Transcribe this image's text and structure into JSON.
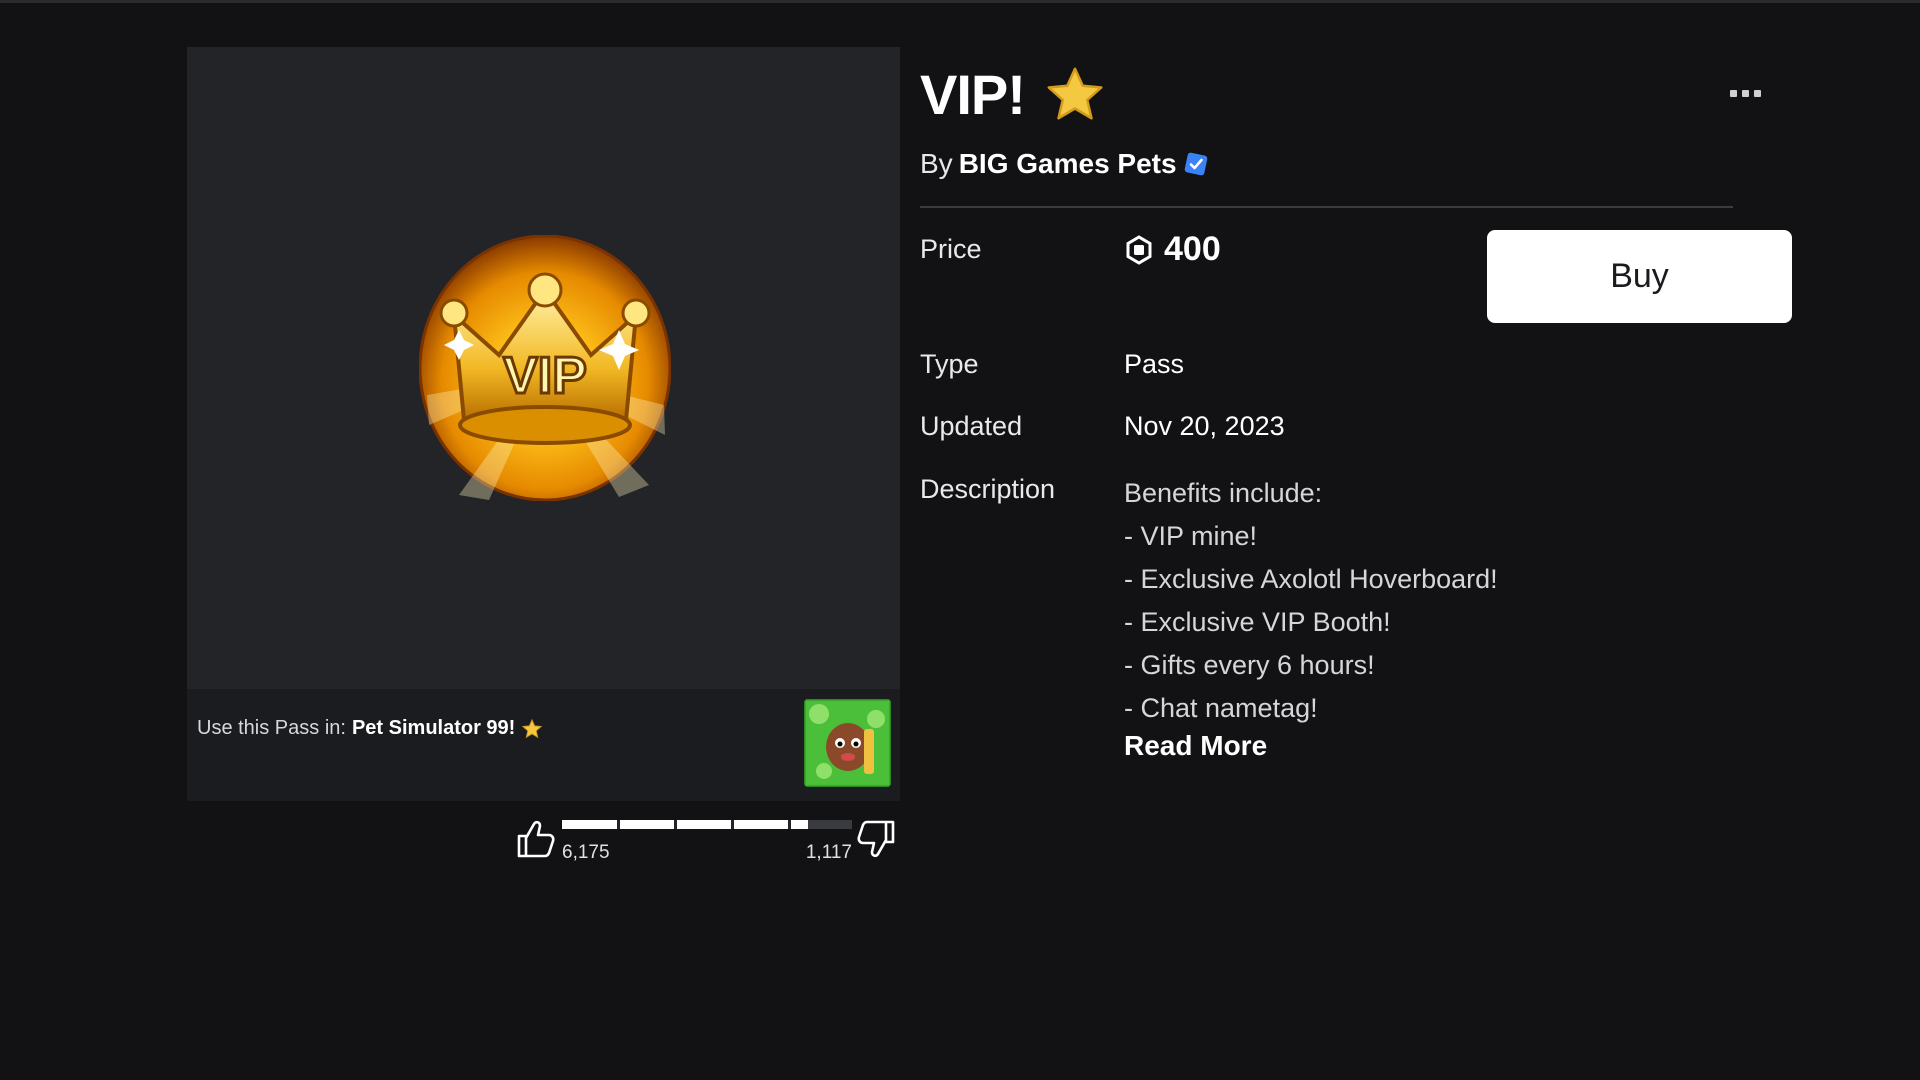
{
  "item": {
    "title": "VIP!",
    "creator_prefix": "By",
    "creator_name": "BIG Games Pets",
    "price_label": "Price",
    "price_value": "400",
    "type_label": "Type",
    "type_value": "Pass",
    "updated_label": "Updated",
    "updated_value": "Nov 20, 2023",
    "description_label": "Description",
    "description_lines": [
      "Benefits include:",
      "- VIP mine!",
      "- Exclusive Axolotl Hoverboard!",
      "- Exclusive VIP Booth!",
      "- Gifts every 6 hours!",
      "- Chat nametag!"
    ],
    "read_more": "Read More",
    "buy_label": "Buy",
    "badge_text": "VIP"
  },
  "use_in": {
    "prefix": "Use this Pass in:",
    "game_name": "Pet Simulator 99!"
  },
  "votes": {
    "up_count": "6,175",
    "down_count": "1,117",
    "up_fraction": 0.847
  },
  "colors": {
    "background": "#121215",
    "card": "#232427",
    "buy_button": "#ffffff",
    "verified": "#3b82f6",
    "star": "#f5c842"
  }
}
